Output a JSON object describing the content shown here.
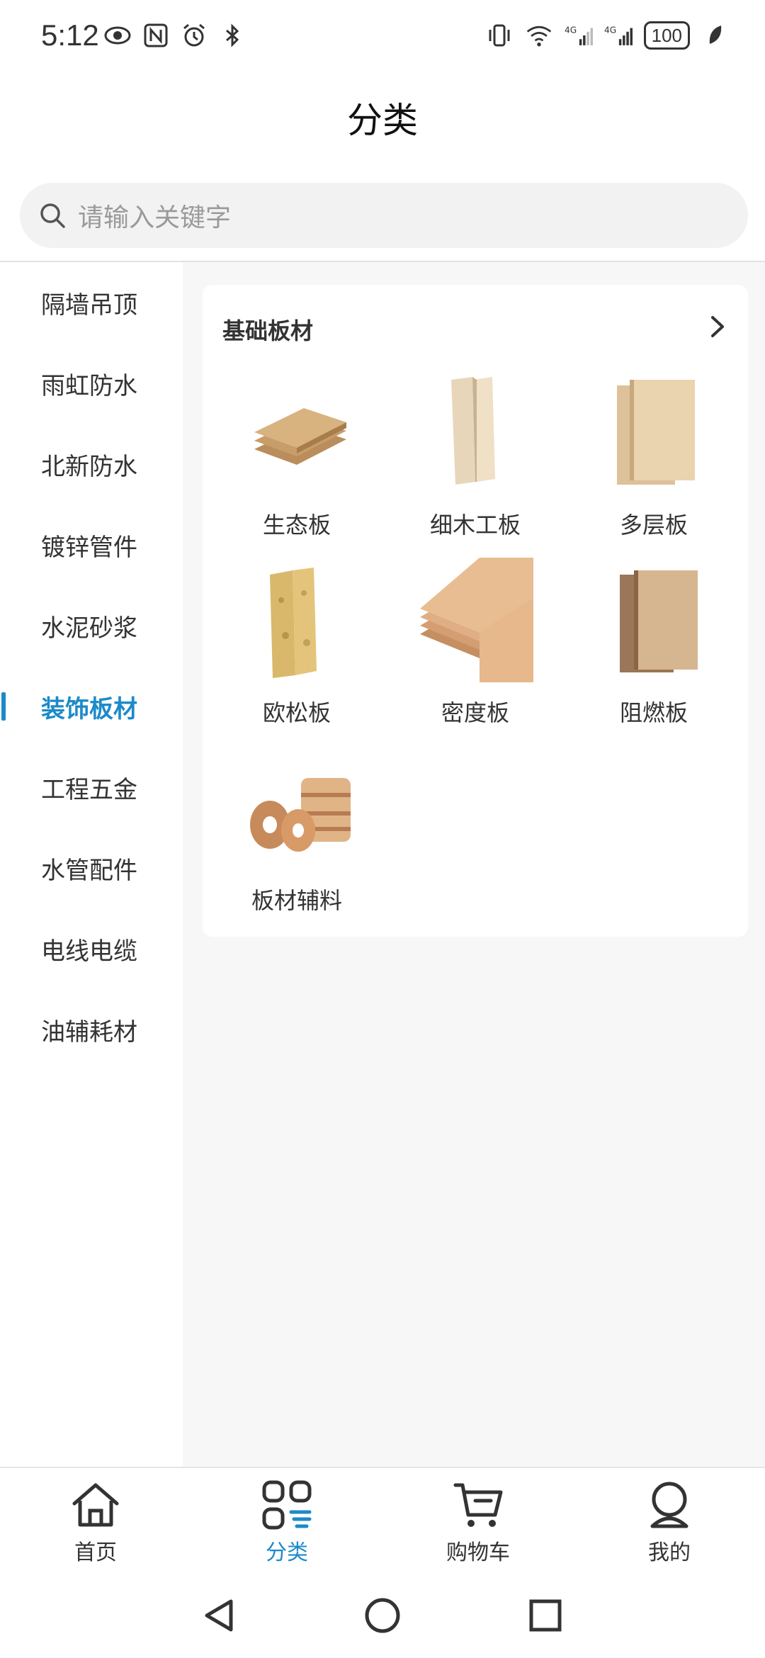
{
  "status_bar": {
    "time": "5:12",
    "battery": "100",
    "left_icons": [
      "eye-icon",
      "nfc-icon",
      "alarm-icon",
      "bluetooth-icon"
    ],
    "right_icons": [
      "vibrate-icon",
      "wifi-icon",
      "signal-4g-icon",
      "signal-4g-icon",
      "battery-icon",
      "leaf-icon"
    ]
  },
  "header": {
    "title": "分类"
  },
  "search": {
    "placeholder": "请输入关键字"
  },
  "sidebar": {
    "items": [
      {
        "label": "隔墙吊顶",
        "active": false
      },
      {
        "label": "雨虹防水",
        "active": false
      },
      {
        "label": "北新防水",
        "active": false
      },
      {
        "label": "镀锌管件",
        "active": false
      },
      {
        "label": "水泥砂浆",
        "active": false
      },
      {
        "label": "装饰板材",
        "active": true
      },
      {
        "label": "工程五金",
        "active": false
      },
      {
        "label": "水管配件",
        "active": false
      },
      {
        "label": "电线电缆",
        "active": false
      },
      {
        "label": "油辅耗材",
        "active": false
      }
    ]
  },
  "category": {
    "title": "基础板材",
    "items": [
      {
        "label": "生态板"
      },
      {
        "label": "细木工板"
      },
      {
        "label": "多层板"
      },
      {
        "label": "欧松板"
      },
      {
        "label": "密度板"
      },
      {
        "label": "阻燃板"
      },
      {
        "label": "板材辅料"
      }
    ]
  },
  "bottom_nav": {
    "items": [
      {
        "label": "首页",
        "icon": "home-icon",
        "active": false
      },
      {
        "label": "分类",
        "icon": "category-icon",
        "active": true
      },
      {
        "label": "购物车",
        "icon": "cart-icon",
        "active": false
      },
      {
        "label": "我的",
        "icon": "profile-icon",
        "active": false
      }
    ]
  },
  "colors": {
    "accent": "#1c8ac9",
    "content_bg": "#f7f7f7",
    "search_bg": "#f2f2f2"
  }
}
